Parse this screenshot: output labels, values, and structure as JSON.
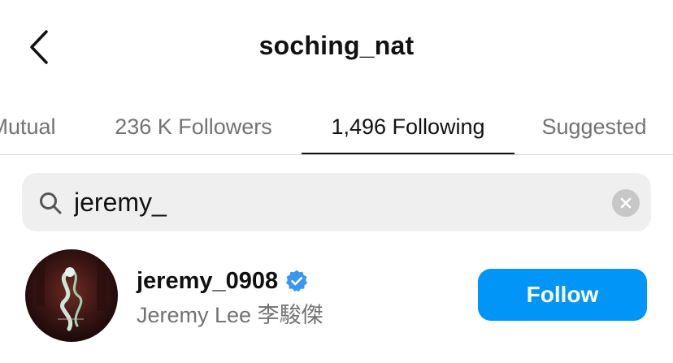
{
  "header": {
    "title": "soching_nat",
    "back_icon": "chevron-left-icon"
  },
  "tabs": [
    {
      "label": "Mutual",
      "active": false
    },
    {
      "label": "236 K Followers",
      "active": false
    },
    {
      "label": "1,496 Following",
      "active": true
    },
    {
      "label": "Suggested",
      "active": false
    }
  ],
  "search": {
    "value": "jeremy_",
    "icon": "search-icon",
    "clear_icon": "clear-icon"
  },
  "results": [
    {
      "username": "jeremy_0908",
      "verified": true,
      "full_name": "Jeremy Lee 李駿傑",
      "button_label": "Follow"
    }
  ],
  "colors": {
    "accent": "#0095f6",
    "secondary_text": "#737373",
    "search_bg": "#efefef"
  }
}
